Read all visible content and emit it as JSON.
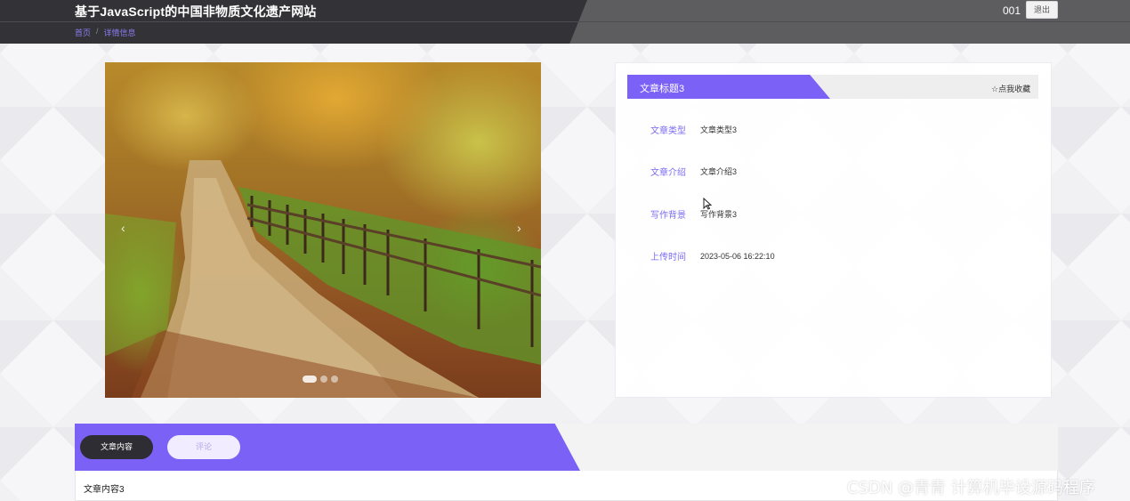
{
  "header": {
    "site_title": "基于JavaScript的中国非物质文化遗产网站",
    "breadcrumb": {
      "home": "首页",
      "separator": "/",
      "current": "详情信息"
    },
    "user": "001",
    "logout_label": "退出"
  },
  "carousel": {
    "image_alt": "秋季林间落叶小路",
    "prev_icon": "‹",
    "next_icon": "›",
    "slide_count": 3,
    "active_slide": 1
  },
  "detail": {
    "title": "文章标题3",
    "favorite_label": "☆点我收藏",
    "fields": [
      {
        "label": "文章类型",
        "value": "文章类型3"
      },
      {
        "label": "文章介绍",
        "value": "文章介绍3"
      },
      {
        "label": "写作背景",
        "value": "写作背景3"
      },
      {
        "label": "上传时间",
        "value": "2023-05-06 16:22:10"
      }
    ]
  },
  "content": {
    "tabs": [
      {
        "label": "文章内容",
        "active": true
      },
      {
        "label": "评论",
        "active": false
      }
    ],
    "body_text": "文章内容3"
  },
  "watermark": "CSDN @青青  计算机毕设源码程序",
  "colors": {
    "accent": "#7b61f6",
    "header_dark": "#333337",
    "header_light": "#5d5d60"
  }
}
